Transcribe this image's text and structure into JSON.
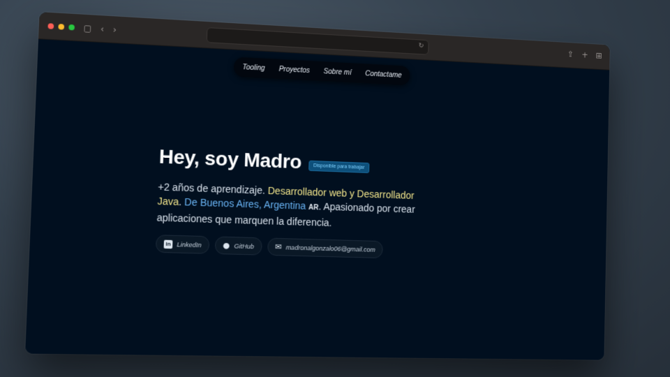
{
  "browser": {
    "icons": [
      "sidebar-icon",
      "back-icon",
      "forward-icon",
      "reload-icon",
      "share-icon",
      "new-tab-icon",
      "tab-overview-icon"
    ]
  },
  "nav": {
    "items": [
      "Tooling",
      "Proyectos",
      "Sobre mí",
      "Contactame"
    ]
  },
  "hero": {
    "title": "Hey, soy Madro",
    "badge": "Disponible para trabajar",
    "bio": {
      "part1": "+2 años de aprendizaje. ",
      "highlight1": "Desarrollador web y Desarrollador Java",
      "part2": ". ",
      "highlight2": "De Buenos Aires, Argentina",
      "flag": "AR",
      "part3": ". Apasionado por crear aplicaciones que marquen la diferencia."
    },
    "links": {
      "linkedin": "LinkedIn",
      "github": "GitHub",
      "email": "madronalgonzalo06@gmail.com"
    }
  },
  "colors": {
    "page_bg": "#010f1f",
    "accent_yellow": "#f1e48b",
    "accent_blue": "#69b4f5",
    "badge_bg": "#0d4f7a"
  }
}
